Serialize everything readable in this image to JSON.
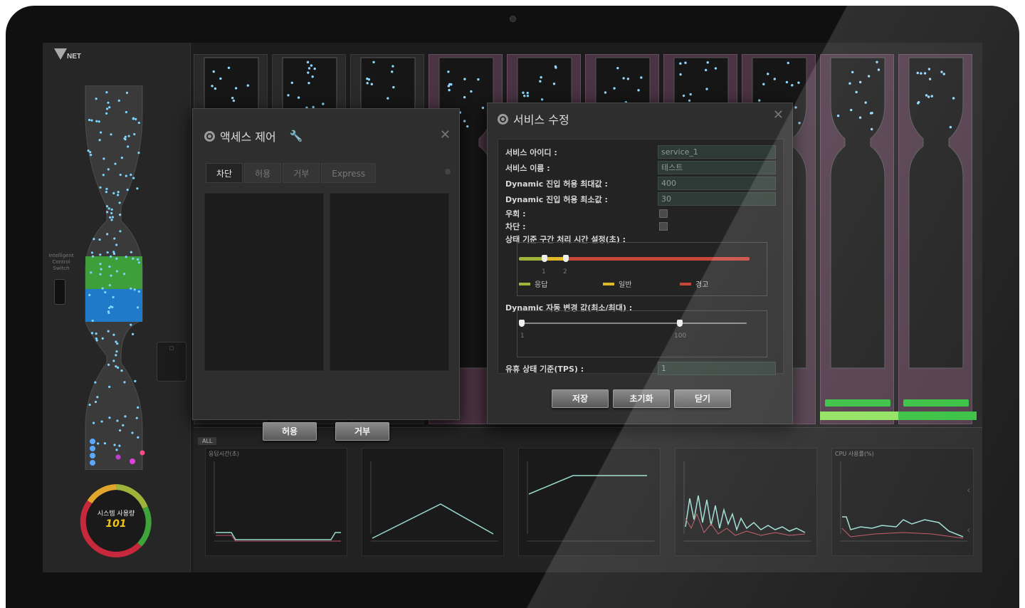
{
  "app": {
    "logo_text": "NET",
    "system_usage_label": "시스템 사용량",
    "system_usage_value": "101",
    "switch_label": "Intelligent Control Switch",
    "colors": {
      "accent_green": "#2fbf3a",
      "accent_blue": "#1f7ac9",
      "alert_red": "#c8283c",
      "warn_purple": "#4a3343"
    }
  },
  "bottom": {
    "tabs": [
      "ALL"
    ],
    "charts": [
      {
        "title": "응답시간(초)"
      },
      {
        "title": ""
      },
      {
        "title": ""
      },
      {
        "title": ""
      },
      {
        "title": "CPU 사용률(%)"
      }
    ]
  },
  "access_dialog": {
    "title": "액세스 제어",
    "tabs": [
      {
        "label": "차단",
        "active": true
      },
      {
        "label": "허용",
        "active": false
      },
      {
        "label": "거부",
        "active": false
      },
      {
        "label": "Express",
        "active": false
      }
    ],
    "allow_button": "허용",
    "deny_button": "거부"
  },
  "service_dialog": {
    "title": "서비스 수정",
    "fields": [
      {
        "label": "서비스 아이디 :",
        "value": "service_1"
      },
      {
        "label": "서비스 이름 :",
        "value": "테스트"
      },
      {
        "label": "Dynamic 진입 허용 최대값 :",
        "value": "400"
      },
      {
        "label": "Dynamic 진입 허용 최소값 :",
        "value": "30"
      }
    ],
    "bypass_label": "우회 :",
    "block_label": "차단 :",
    "threshold_label": "상태 기준 구간 처리 시간 설정(초) :",
    "threshold_ticks": [
      "1",
      "2"
    ],
    "threshold_values": [
      1,
      2
    ],
    "legend": [
      {
        "label": "응답",
        "color": "#9db33a"
      },
      {
        "label": "일반",
        "color": "#e0b92a"
      },
      {
        "label": "경고",
        "color": "#c8453a"
      }
    ],
    "dynamic_label": "Dynamic 자동 변경 값(최소/최대) :",
    "dynamic_ticks": [
      "1",
      "100"
    ],
    "dynamic_min": 1,
    "dynamic_max": 100,
    "idle_label": "유휴 상태 기준(TPS) :",
    "idle_value": "1",
    "buttons": {
      "save": "저장",
      "reset": "초기화",
      "close": "닫기"
    }
  }
}
